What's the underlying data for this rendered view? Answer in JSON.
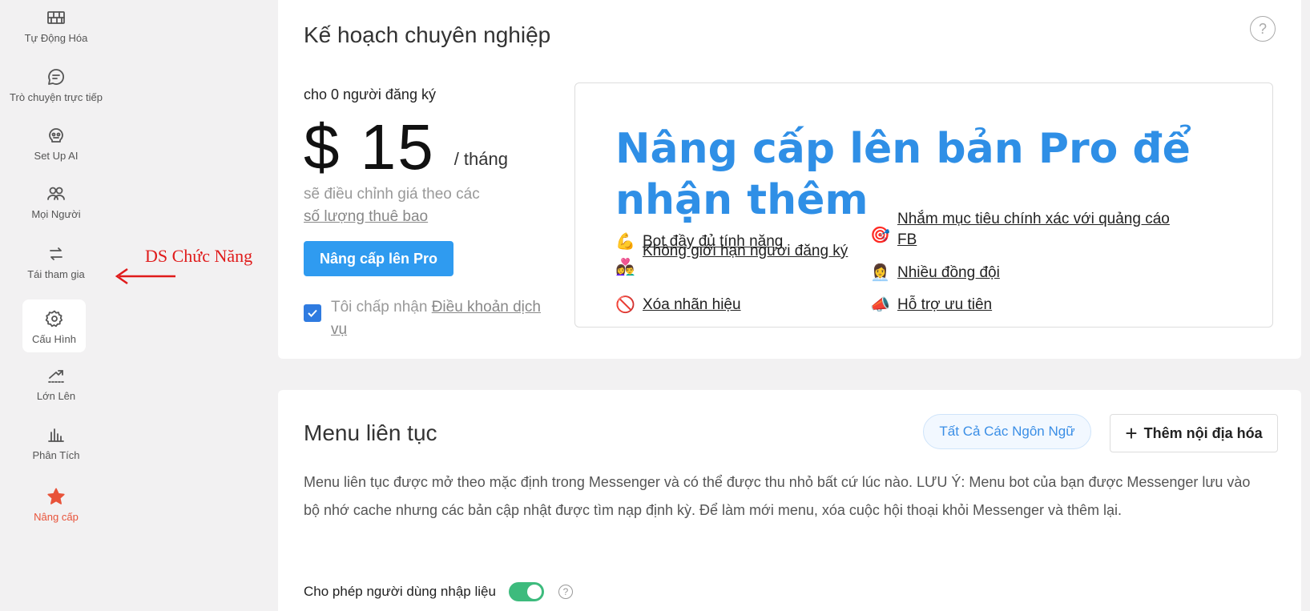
{
  "sidebar": {
    "items": [
      {
        "label": "Tự Động Hóa",
        "icon": "bricks-icon"
      },
      {
        "label": "Trò chuyện trực tiếp",
        "icon": "chat-icon"
      },
      {
        "label": "Set Up AI",
        "icon": "brain-icon"
      },
      {
        "label": "Mọi Người",
        "icon": "people-icon"
      },
      {
        "label": "Tái tham gia",
        "icon": "swap-arrows-icon"
      },
      {
        "label": "Cấu Hình",
        "icon": "gear-icon"
      },
      {
        "label": "Lớn Lên",
        "icon": "growth-icon"
      },
      {
        "label": "Phân Tích",
        "icon": "bar-chart-icon"
      },
      {
        "label": "Nâng cấp",
        "icon": "star-icon"
      }
    ]
  },
  "annotation": {
    "text": "DS Chức Năng",
    "color": "#e01b1b"
  },
  "plan": {
    "title": "Kế hoạch chuyên nghiệp",
    "help": "?",
    "subscribers": "cho 0 người đăng ký",
    "price": "$ 15",
    "per": "/ tháng",
    "adjust_prefix": "sẽ điều chỉnh giá theo các",
    "adjust_link": "số lượng thuê bao",
    "upgrade_button": "Nâng cấp lên Pro",
    "terms_prefix": "Tôi chấp nhận",
    "terms_link": "Điều khoản dịch vụ",
    "terms_checked": true
  },
  "promo": {
    "title": "Nâng cấp lên bản Pro để nhận thêm",
    "features": [
      {
        "emoji": "💪",
        "text": "Bot đầy đủ tính năng"
      },
      {
        "emoji": "👩‍❤️‍👨",
        "text": "Không giới hạn người đăng ký"
      },
      {
        "emoji": "🚫",
        "text": "Xóa nhãn hiệu"
      },
      {
        "emoji": "🎯",
        "text": "Nhắm mục tiêu chính xác với quảng cáo FB"
      },
      {
        "emoji": "👩‍💼",
        "text": "Nhiều đồng đội"
      },
      {
        "emoji": "📣",
        "text": "Hỗ trợ ưu tiên"
      }
    ]
  },
  "menu": {
    "title": "Menu liên tục",
    "lang_button": "Tất Cả Các Ngôn Ngữ",
    "add_button": "Thêm nội địa hóa",
    "description": "Menu liên tục được mở theo mặc định trong Messenger và có thể được thu nhỏ bất cứ lúc nào. LƯU Ý: Menu bot của bạn được Messenger lưu vào bộ nhớ cache nhưng các bản cập nhật được tìm nạp định kỳ. Để làm mới menu, xóa cuộc hội thoại khỏi Messenger và thêm lại.",
    "input_label": "Cho phép người dùng nhập liệu",
    "input_enabled": true
  },
  "colors": {
    "accent": "#2f9bf0",
    "promo_title": "#2f8fe6",
    "upgrade": "#e8533a",
    "toggle_on": "#3dbb7d"
  }
}
